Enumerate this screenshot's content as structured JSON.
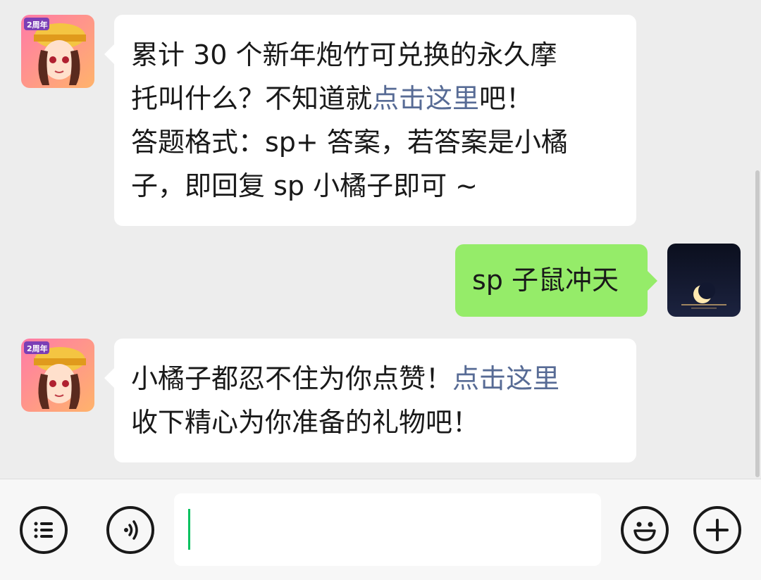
{
  "messages": [
    {
      "side": "left",
      "sender": "game-account",
      "parts": [
        {
          "text": "累计 30 个新年炮竹可兑换的永久摩",
          "link": false
        },
        {
          "text": "托叫什么？不知道就",
          "link": false
        },
        {
          "text": "点击这里",
          "link": true
        },
        {
          "text": "吧！",
          "link": false
        },
        {
          "text": "答题格式：sp+ 答案，若答案是小橘",
          "link": false
        },
        {
          "text": "子，即回复 sp 小橘子即可 ~",
          "link": false
        }
      ]
    },
    {
      "side": "right",
      "sender": "me",
      "parts": [
        {
          "text": "sp 子鼠冲天",
          "link": false
        }
      ]
    },
    {
      "side": "left",
      "sender": "game-account",
      "parts": [
        {
          "text": "小橘子都忍不住为你点赞！",
          "link": false
        },
        {
          "text": "点击这里",
          "link": true
        },
        {
          "text": "收下精心为你准备的礼物吧！",
          "link": false
        }
      ]
    }
  ],
  "avatar_badge": "2周年",
  "input": {
    "value": ""
  },
  "icons": {
    "menu": "list-menu-icon",
    "voice": "voice-icon",
    "emoji": "emoji-icon",
    "more": "plus-icon"
  },
  "colors": {
    "background": "#ededed",
    "bubble_left": "#ffffff",
    "bubble_right": "#95ec69",
    "link": "#576b95",
    "caret": "#07c160"
  }
}
